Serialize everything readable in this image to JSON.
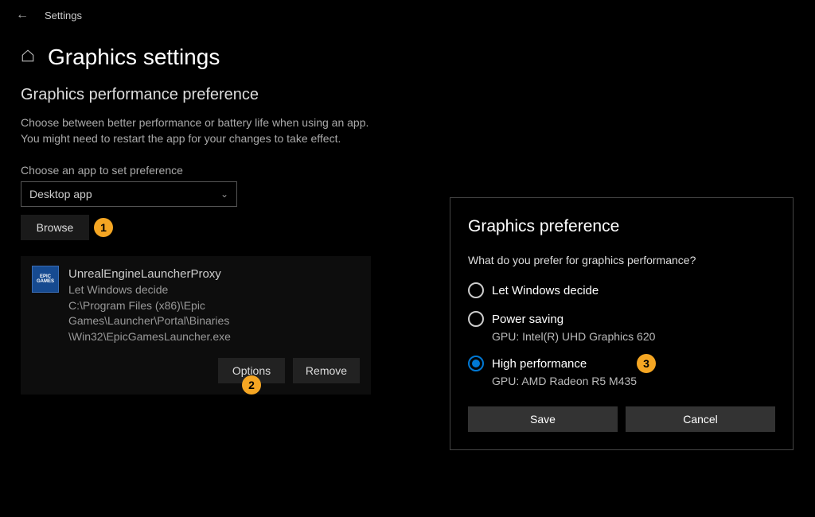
{
  "topbar": {
    "title": "Settings"
  },
  "header": {
    "page_title": "Graphics settings"
  },
  "section": {
    "title": "Graphics performance preference",
    "description_line1": "Choose between better performance or battery life when using an app.",
    "description_line2": "You might need to restart the app for your changes to take effect.",
    "choose_label": "Choose an app to set preference",
    "dropdown_value": "Desktop app",
    "browse_label": "Browse"
  },
  "app": {
    "name": "UnrealEngineLauncherProxy",
    "pref": "Let Windows decide",
    "path_line1": "C:\\Program Files (x86)\\Epic Games\\Launcher\\Portal\\Binaries",
    "path_line2": "\\Win32\\EpicGamesLauncher.exe",
    "options_label": "Options",
    "remove_label": "Remove",
    "icon_text1": "EPIC",
    "icon_text2": "GAMES"
  },
  "dialog": {
    "title": "Graphics preference",
    "question": "What do you prefer for graphics performance?",
    "radios": {
      "decide": {
        "label": "Let Windows decide"
      },
      "power": {
        "label": "Power saving",
        "sub": "GPU: Intel(R) UHD Graphics 620"
      },
      "high": {
        "label": "High performance",
        "sub": "GPU: AMD Radeon R5 M435"
      }
    },
    "save_label": "Save",
    "cancel_label": "Cancel"
  },
  "badges": {
    "b1": "1",
    "b2": "2",
    "b3": "3"
  }
}
